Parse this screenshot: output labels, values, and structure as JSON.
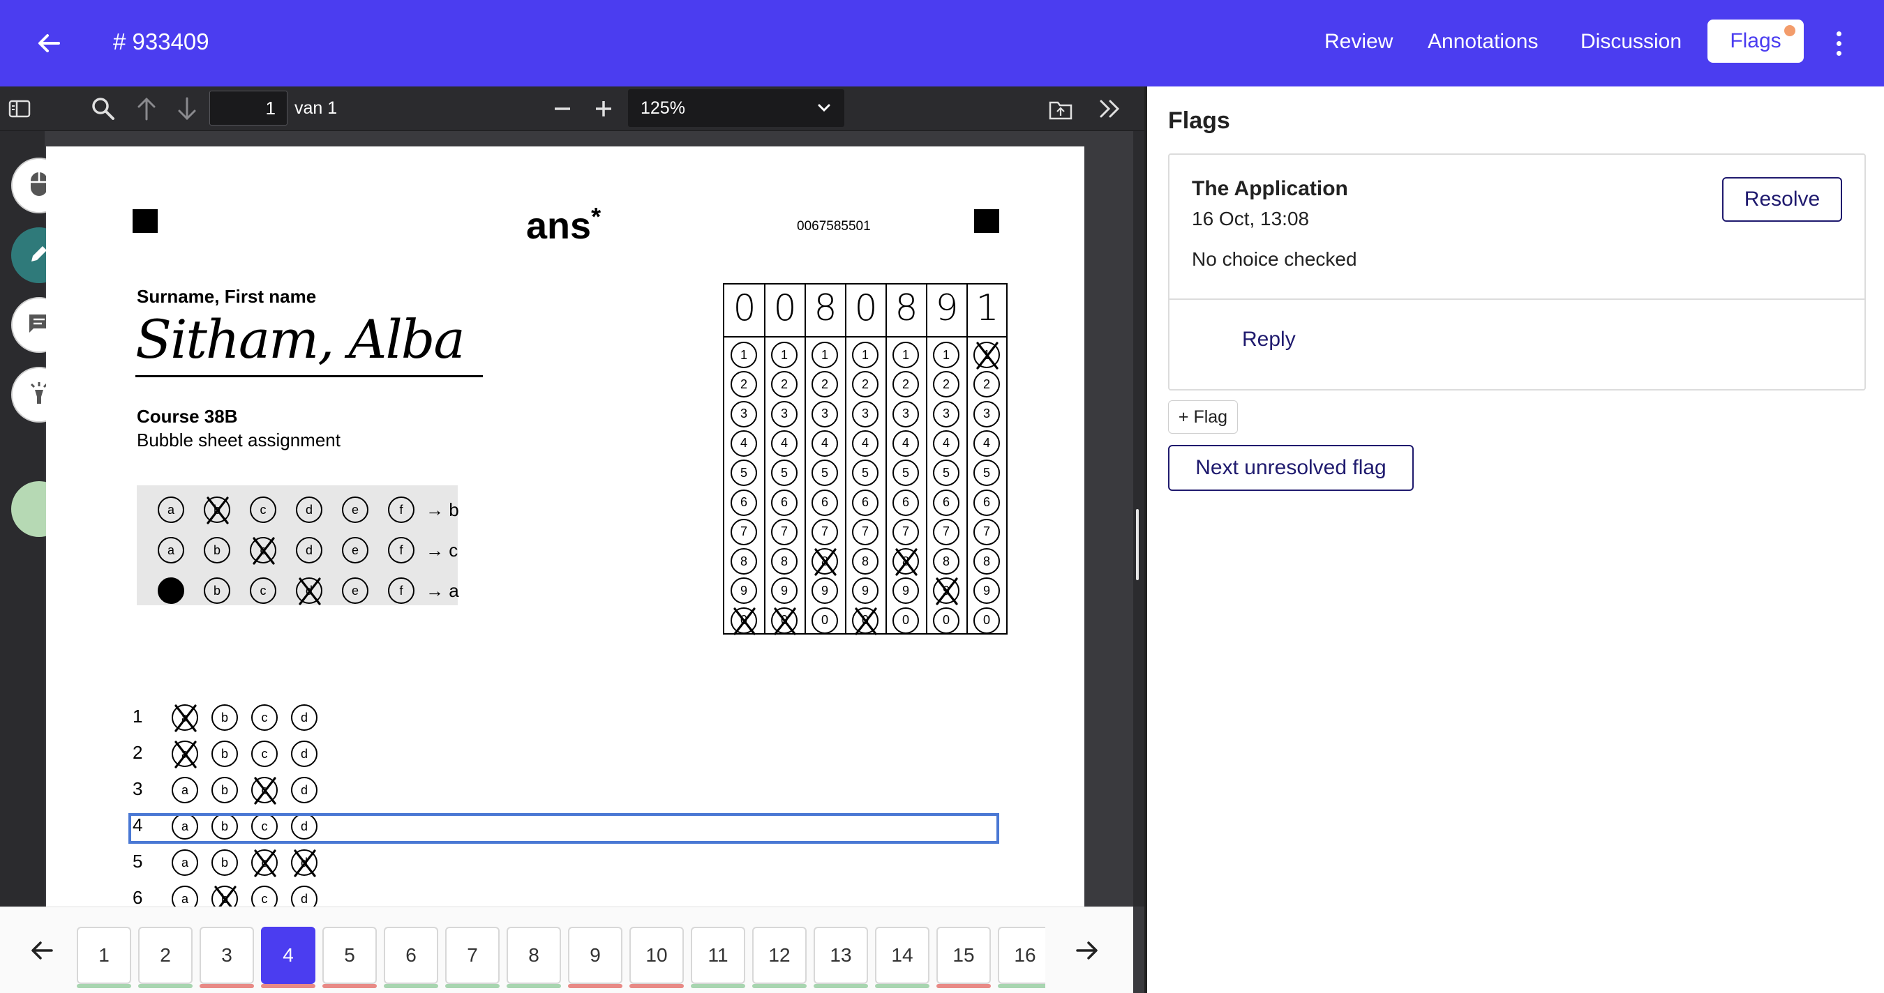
{
  "header": {
    "submission_id": "# 933409",
    "nav": {
      "review": "Review",
      "annotations": "Annotations",
      "discussion": "Discussion",
      "flags": "Flags"
    }
  },
  "toolbar": {
    "page_current": "1",
    "page_of": "van 1",
    "zoom": "125%"
  },
  "document": {
    "logo": "ans",
    "logo_mark": "*",
    "code": "0067585501",
    "name_label": "Surname, First name",
    "signature": "Sitham, Alba",
    "course": "Course 38B",
    "assignment": "Bubble sheet assignment",
    "example_letters": [
      "a",
      "b",
      "c",
      "d",
      "e",
      "f"
    ],
    "examples": [
      {
        "marks": [
          0,
          1,
          0,
          0,
          0,
          0
        ],
        "result": "→ b"
      },
      {
        "marks": [
          0,
          0,
          1,
          0,
          0,
          0
        ],
        "result": "→ c"
      },
      {
        "marks": [
          2,
          0,
          0,
          1,
          0,
          0
        ],
        "result": "→ a"
      }
    ],
    "student_id_digits": [
      "0",
      "0",
      "8",
      "0",
      "8",
      "9",
      "1"
    ],
    "id_bubble_labels": [
      "1",
      "2",
      "3",
      "4",
      "5",
      "6",
      "7",
      "8",
      "9",
      "0"
    ],
    "id_marked_rows": [
      9,
      9,
      7,
      9,
      7,
      8,
      0
    ],
    "question_letters": [
      "a",
      "b",
      "c",
      "d"
    ],
    "questions": [
      {
        "num": "1",
        "marked": [
          0
        ]
      },
      {
        "num": "2",
        "marked": [
          0
        ]
      },
      {
        "num": "3",
        "marked": [
          2
        ]
      },
      {
        "num": "4",
        "marked": []
      },
      {
        "num": "5",
        "marked": [
          2,
          3
        ]
      },
      {
        "num": "6",
        "marked": [
          1
        ]
      }
    ],
    "highlighted_question": "4"
  },
  "pager": {
    "pages": [
      "1",
      "2",
      "3",
      "4",
      "5",
      "6",
      "7",
      "8",
      "9",
      "10",
      "11",
      "12",
      "13",
      "14",
      "15",
      "16"
    ],
    "active": "4",
    "status": [
      "ok",
      "ok",
      "bad",
      "bad",
      "bad",
      "ok",
      "ok",
      "ok",
      "bad",
      "bad",
      "ok",
      "ok",
      "ok",
      "ok",
      "bad",
      "ok"
    ],
    "status_colors": {
      "ok": "#a8d5b0",
      "bad": "#e88a86"
    }
  },
  "flags_panel": {
    "title": "Flags",
    "flag": {
      "author": "The Application",
      "time": "16 Oct, 13:08",
      "message": "No choice checked",
      "resolve_label": "Resolve",
      "reply_label": "Reply"
    },
    "add_flag_label": "+ Flag",
    "next_label": "Next unresolved flag"
  },
  "colors": {
    "brand": "#4b3df0",
    "active_tool": "#2f7a7a",
    "swatch": "#b6d9b4",
    "highlight": "#4a78d4"
  }
}
